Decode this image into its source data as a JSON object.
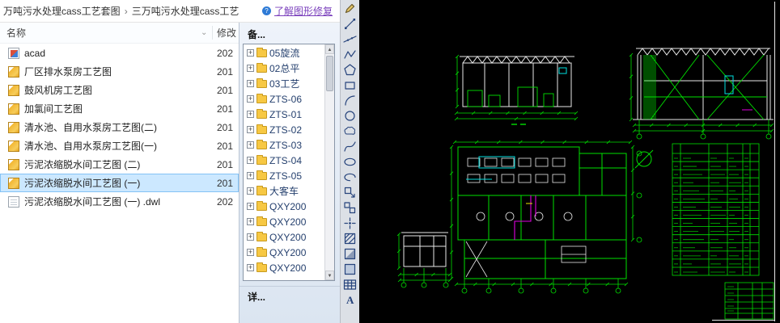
{
  "top": {
    "breadcrumb": [
      "万吨污水处理cass工艺套图",
      "三万吨污水处理cass工艺"
    ],
    "recover_link": "了解图形修复"
  },
  "explorer": {
    "columns": {
      "name": "名称",
      "modified": "修改"
    },
    "files": [
      {
        "name": "acad",
        "date": "202",
        "icon": "file",
        "selected": false
      },
      {
        "name": "厂区排水泵房工艺图",
        "date": "201",
        "icon": "dwg",
        "selected": false
      },
      {
        "name": "鼓风机房工艺图",
        "date": "201",
        "icon": "dwg",
        "selected": false
      },
      {
        "name": "加氯间工艺图",
        "date": "201",
        "icon": "dwg",
        "selected": false
      },
      {
        "name": "清水池、自用水泵房工艺图(二)",
        "date": "201",
        "icon": "dwg",
        "selected": false
      },
      {
        "name": "清水池、自用水泵房工艺图(一)",
        "date": "201",
        "icon": "dwg",
        "selected": false
      },
      {
        "name": "污泥浓缩脱水间工艺图 (二)",
        "date": "201",
        "icon": "dwg",
        "selected": false
      },
      {
        "name": "污泥浓缩脱水间工艺图 (一)",
        "date": "201",
        "icon": "dwg",
        "selected": true
      },
      {
        "name": "污泥浓缩脱水间工艺图 (一) .dwl",
        "date": "202",
        "icon": "plain",
        "selected": false
      }
    ]
  },
  "panel": {
    "header": "备...",
    "items": [
      "05旋流",
      "02总平",
      "03工艺",
      "ZTS-06",
      "ZTS-01",
      "ZTS-02",
      "ZTS-03",
      "ZTS-04",
      "ZTS-05",
      "大客车",
      "QXY200",
      "QXY200",
      "QXY200",
      "QXY200",
      "QXY200"
    ],
    "footer": "详..."
  },
  "toolbar": {
    "tools": [
      "pencil",
      "line",
      "construction-line",
      "polyline",
      "polygon",
      "rectangle",
      "arc",
      "circle",
      "revision-cloud",
      "spline",
      "ellipse",
      "ellipse-arc",
      "insert-block",
      "make-block",
      "point",
      "hatch",
      "gradient",
      "region",
      "table",
      "multiline-text"
    ]
  },
  "icons": {
    "breadcrumb_chevron": "›",
    "column_filter_chevron": "⌄",
    "scroll_up": "▲",
    "scroll_down": "▼",
    "tree_expand": "+",
    "info_badge": "?"
  },
  "canvas": {
    "background": "#000000",
    "line_colors": {
      "primary": "#e8e8e8",
      "dimension_green": "#00e000",
      "highlight_cyan": "#00e0e0",
      "highlight_magenta": "#e000e0",
      "highlight_yellow": "#e8e800"
    }
  }
}
